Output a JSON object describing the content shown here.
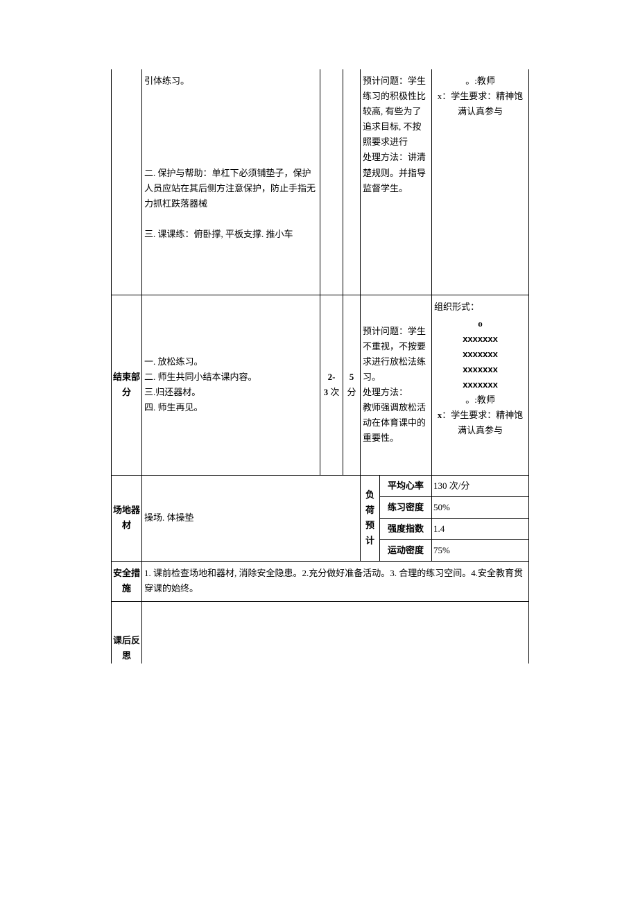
{
  "row1": {
    "content": "引体练习。\n\n\n\n\n\n二. 保护与帮助：单杠下必须铺垫子，保护人员应站在其后侧方注意保护，防止手指无力抓杠跌落器械\n\n三. 课课练：俯卧撑, 平板支撑. 推小车",
    "issues": "预计问题：学生练习的积极性比较高, 有些为了追求目标, 不按照要求进行\n处理方法：讲清楚规则。并指导监督学生。",
    "org": "。:教师\nx：学生要求：精神饱满认真参与",
    "x_bold_teacher": "x"
  },
  "row2": {
    "section": "结束部分",
    "content": "一. 放松练习。\n二. 师生共同小结本课内容。\n三.归还器材。\n四. 师生再见。",
    "reps": "2-3 次",
    "reps_bold": "2-",
    "reps_bold2": "3",
    "reps_suffix": " 次",
    "time": "5 分",
    "time_bold": "5",
    "time_suffix": " 分",
    "issues": "预计问题：学生不重视，不按要求进行放松法练习。\n处理方法：\n教师强调放松活动在体育课中的重要性。",
    "org_header": "组织形式：",
    "org_teacher": "。:教师",
    "org_req_prefix": "x",
    "org_req": "：学生要求：精神饱满认真参与",
    "x_line": "xxxxxxx",
    "dot": "o"
  },
  "equip": {
    "section": "场地器材",
    "content": "操场. 体操垫",
    "load_label": "负荷预计",
    "metrics": [
      {
        "label": "平均心率",
        "value": "130 次/分"
      },
      {
        "label": "练习密度",
        "value": "50%"
      },
      {
        "label": "强度指数",
        "value": "1.4"
      },
      {
        "label": "运动密度",
        "value": "75%"
      }
    ]
  },
  "safety": {
    "section": "安全措施",
    "content": "1. 课前检查场地和器材, 消除安全隐患。2.充分做好准备活动。3. 合理的练习空间。4.安全教育贯穿课的始终。"
  },
  "reflect": {
    "section": "课后反思"
  }
}
